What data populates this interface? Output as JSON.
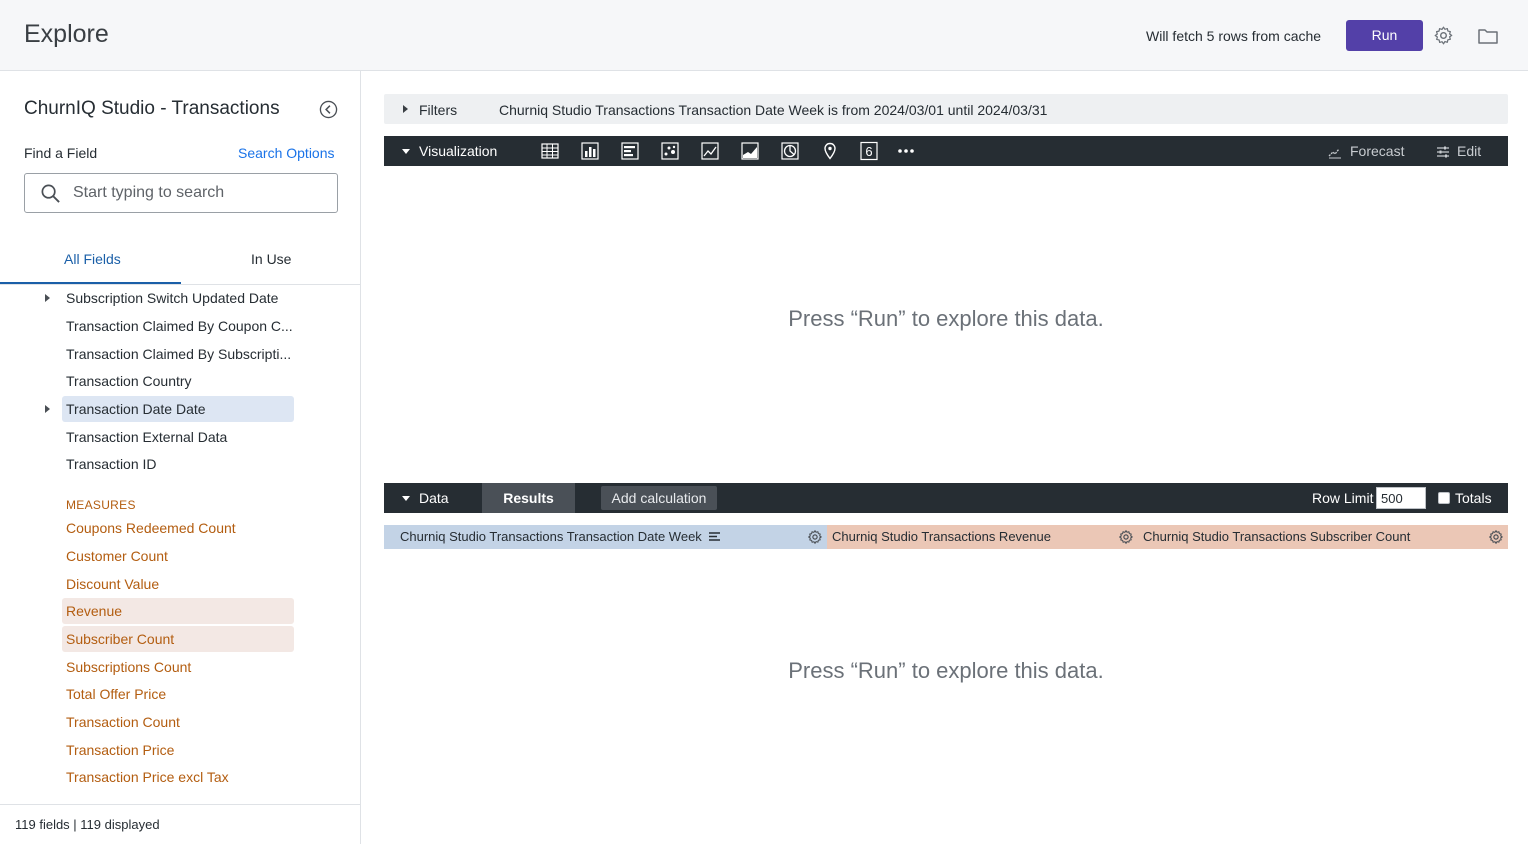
{
  "header": {
    "title": "Explore",
    "cache_text": "Will fetch 5 rows from cache",
    "run_label": "Run",
    "icons": [
      "gear-icon",
      "folder-icon"
    ]
  },
  "sidebar": {
    "model_title": "ChurnIQ Studio - Transactions",
    "find_label": "Find a Field",
    "search_options_label": "Search Options",
    "search_placeholder": "Start typing to search",
    "tabs": [
      {
        "label": "All Fields",
        "active": true
      },
      {
        "label": "In Use",
        "active": false
      }
    ],
    "dimensions": [
      {
        "label": "Subscription Switch Updated Date",
        "expandable": true,
        "selected": false
      },
      {
        "label": "Transaction Claimed By Coupon C...",
        "expandable": false,
        "selected": false
      },
      {
        "label": "Transaction Claimed By Subscripti...",
        "expandable": false,
        "selected": false
      },
      {
        "label": "Transaction Country",
        "expandable": false,
        "selected": false
      },
      {
        "label": "Transaction Date Date",
        "expandable": true,
        "selected": true
      },
      {
        "label": "Transaction External Data",
        "expandable": false,
        "selected": false
      },
      {
        "label": "Transaction ID",
        "expandable": false,
        "selected": false
      }
    ],
    "measures_heading": "MEASURES",
    "measures": [
      {
        "label": "Coupons Redeemed Count",
        "selected": false
      },
      {
        "label": "Customer Count",
        "selected": false
      },
      {
        "label": "Discount Value",
        "selected": false
      },
      {
        "label": "Revenue",
        "selected": true
      },
      {
        "label": "Subscriber Count",
        "selected": true
      },
      {
        "label": "Subscriptions Count",
        "selected": false
      },
      {
        "label": "Total Offer Price",
        "selected": false
      },
      {
        "label": "Transaction Count",
        "selected": false
      },
      {
        "label": "Transaction Price",
        "selected": false
      },
      {
        "label": "Transaction Price excl Tax",
        "selected": false
      }
    ],
    "footer": "119 fields | 119 displayed"
  },
  "filters": {
    "label": "Filters",
    "text": "Churniq Studio Transactions Transaction Date Week is from 2024/03/01 until 2024/03/31"
  },
  "visualization": {
    "label": "Visualization",
    "types": [
      "table-icon",
      "column-chart-icon",
      "bar-chart-icon",
      "scatter-icon",
      "line-chart-icon",
      "area-chart-icon",
      "pie-chart-icon",
      "map-pin-icon",
      "single-value-icon",
      "more-icon"
    ],
    "single_value_glyph": "6",
    "forecast_label": "Forecast",
    "edit_label": "Edit",
    "empty_message": "Press “Run” to explore this data."
  },
  "data": {
    "label": "Data",
    "results_label": "Results",
    "add_calc_label": "Add calculation",
    "row_limit_label": "Row Limit",
    "row_limit_value": "500",
    "totals_label": "Totals",
    "totals_checked": false,
    "columns": [
      {
        "label": "Churniq Studio Transactions Transaction Date Week",
        "kind": "dimension"
      },
      {
        "label": "Churniq Studio Transactions Revenue",
        "kind": "measure"
      },
      {
        "label": "Churniq Studio Transactions Subscriber Count",
        "kind": "measure"
      }
    ],
    "empty_message": "Press “Run” to explore this data."
  },
  "colors": {
    "run_button": "#5340a8",
    "dark_bar": "#262d33",
    "dimension_header": "#c3d3e6",
    "measure_header": "#ebc7b6",
    "measure_text": "#b35d10",
    "link": "#1a73e8"
  }
}
